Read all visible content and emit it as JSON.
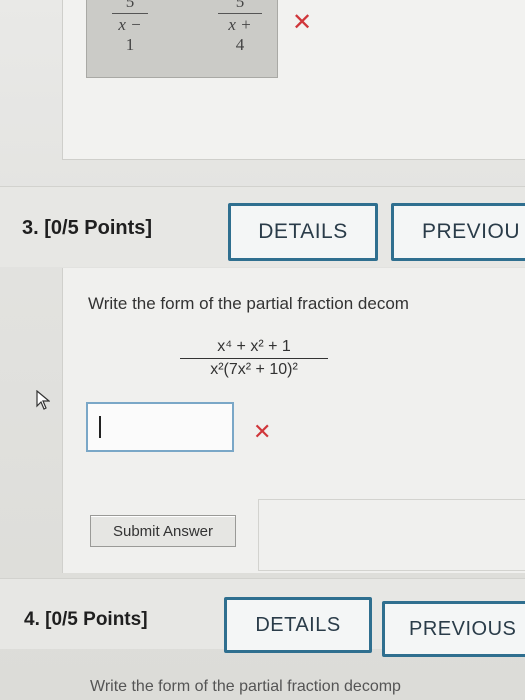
{
  "prev_question": {
    "fraction_a": {
      "numerator": "5",
      "denominator_top": "x −",
      "denominator_bottom": "1"
    },
    "fraction_b": {
      "numerator": "5",
      "denominator_top": "x +",
      "denominator_bottom": "4"
    },
    "incorrect_mark": "✕"
  },
  "question3": {
    "number_label": "3. [0/5 Points]",
    "details_label": "DETAILS",
    "previous_label": "PREVIOU",
    "prompt": "Write the form of the partial fraction decom",
    "expression": {
      "numerator": "x⁴ + x² + 1",
      "denominator": "x²(7x² + 10)²"
    },
    "answer_value": "",
    "incorrect_mark": "✕",
    "submit_label": "Submit Answer"
  },
  "question4": {
    "number_label": "4. [0/5 Points]",
    "details_label": "DETAILS",
    "previous_label": "PREVIOUS",
    "prompt": "Write the form of the partial fraction decomp"
  },
  "colors": {
    "accent_border": "#2f6f8f",
    "input_border": "#7aa7c7",
    "error_red": "#d0363a"
  }
}
